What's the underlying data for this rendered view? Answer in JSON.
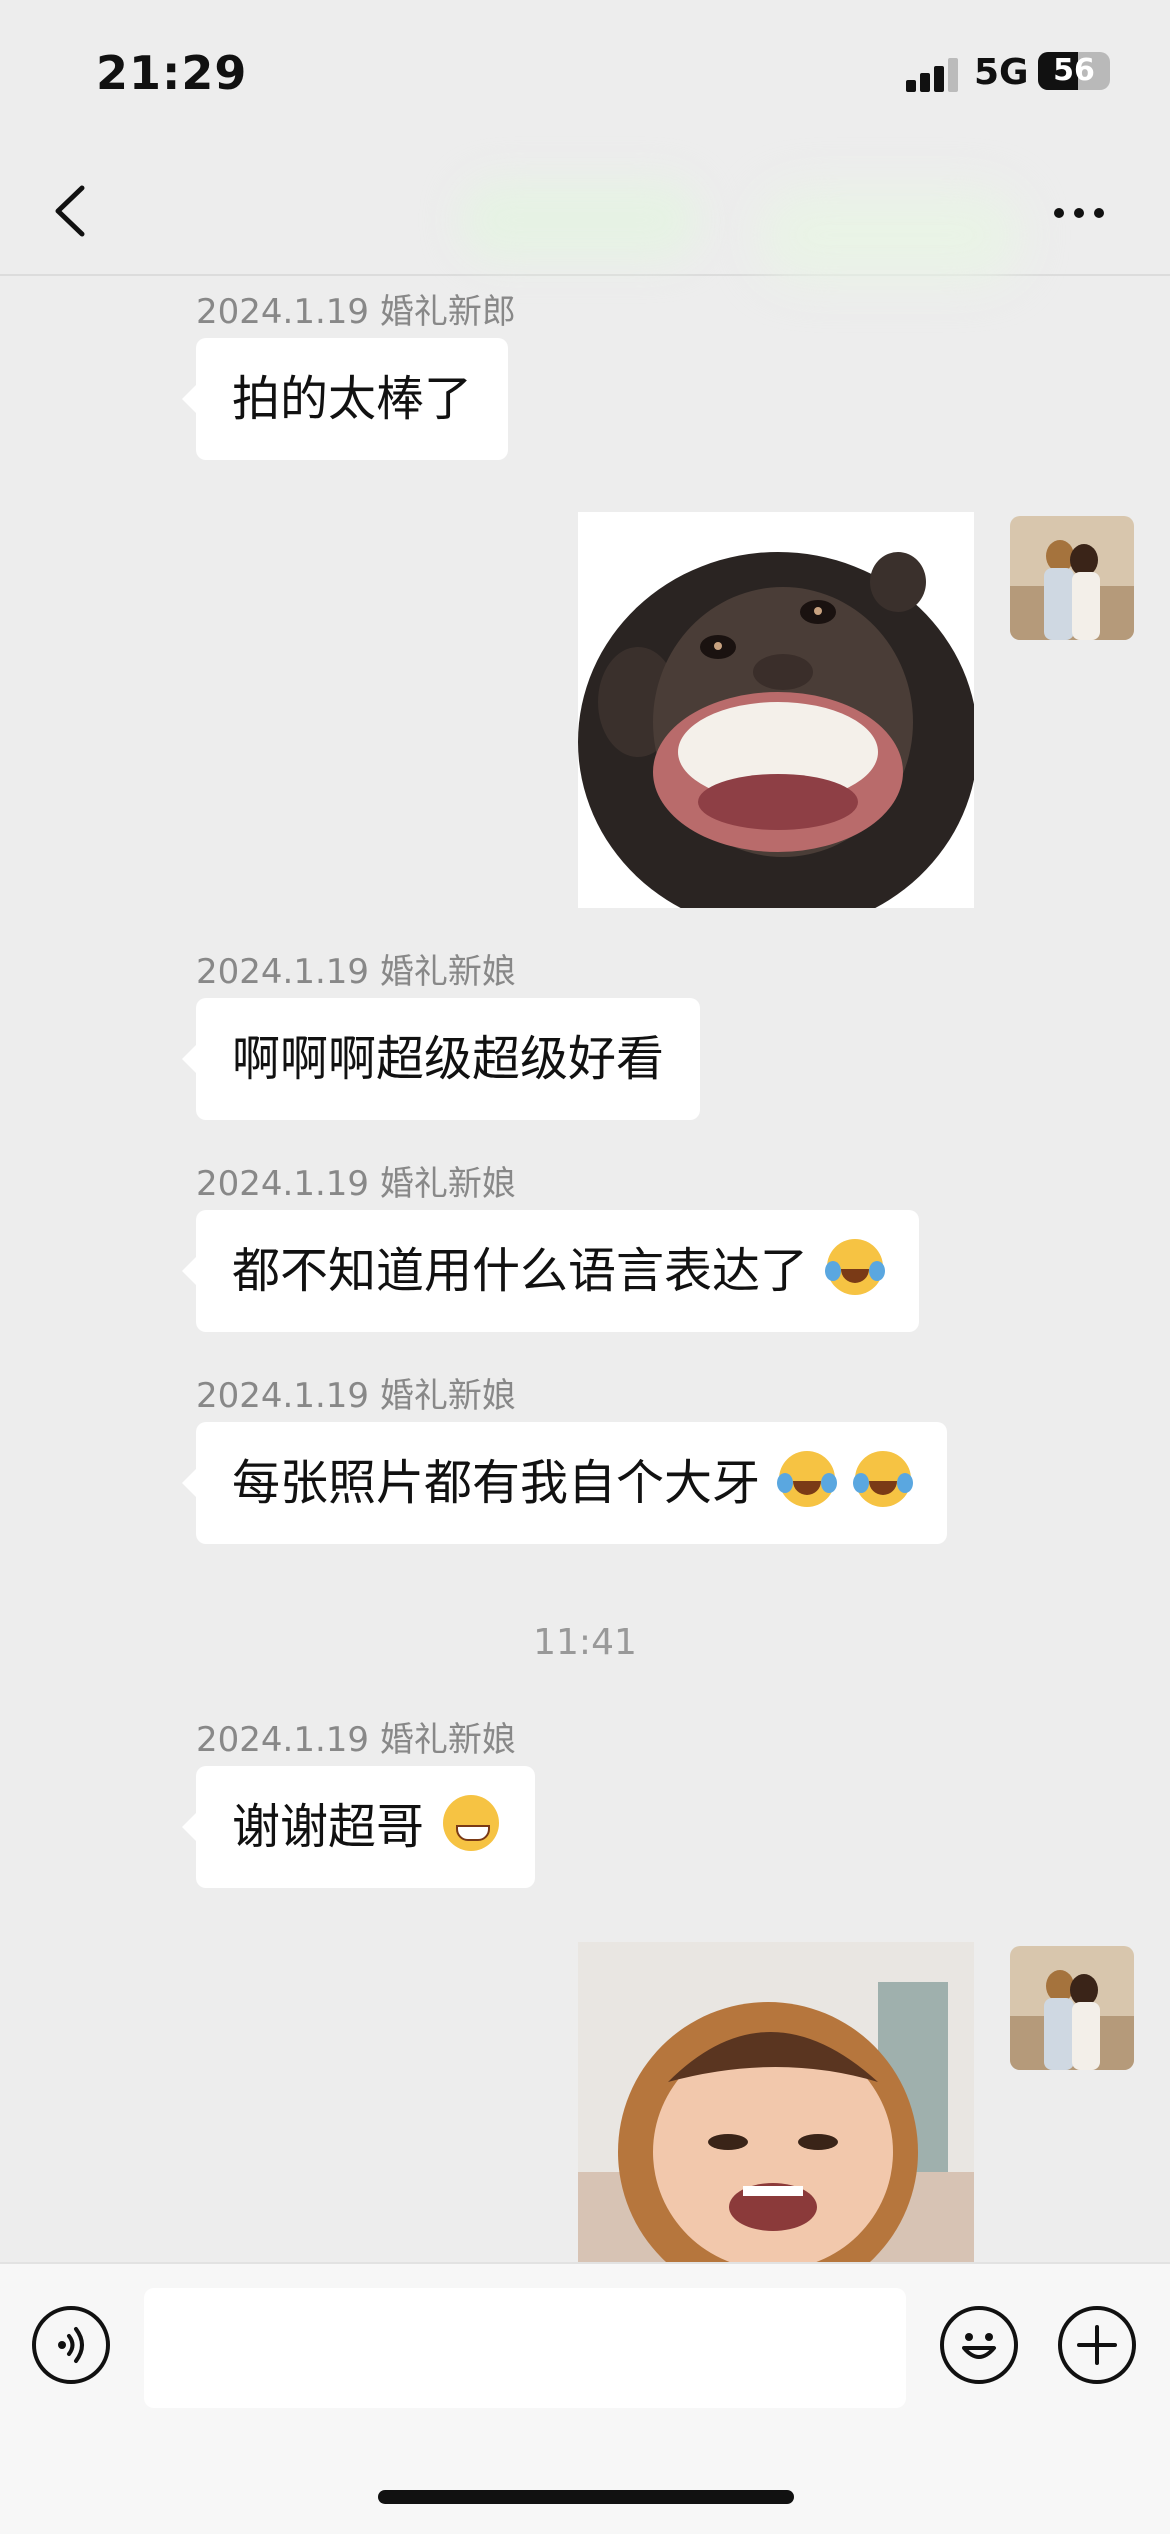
{
  "status_bar": {
    "time": "21:29",
    "network": "5G",
    "battery": "56",
    "battery_level": 0.56
  },
  "nav": {
    "back_icon": "chevron-left-icon",
    "more_icon": "more-dots-icon"
  },
  "messages": [
    {
      "sender": "2024.1.19 婚礼新郎",
      "text": "拍的太棒了"
    },
    {
      "sticker": "grinning-chimp-sticker"
    },
    {
      "sender": "2024.1.19 婚礼新娘",
      "text": "啊啊啊超级超级好看"
    },
    {
      "sender": "2024.1.19 婚礼新娘",
      "text": "都不知道用什么语言表达了",
      "emoji": "laugh-cry-emoji"
    },
    {
      "sender": "2024.1.19 婚礼新娘",
      "text": "每张照片都有我自个大牙",
      "emoji": "laugh-cry-emoji"
    },
    {
      "time_divider": "11:41"
    },
    {
      "sender": "2024.1.19 婚礼新娘",
      "text": "谢谢超哥",
      "emoji": "grin-emoji"
    },
    {
      "sticker": "laughing-baby-sticker"
    }
  ],
  "input_bar": {
    "placeholder": "",
    "voice_icon": "voice-icon",
    "emoji_icon": "emoji-icon",
    "plus_icon": "plus-icon"
  }
}
